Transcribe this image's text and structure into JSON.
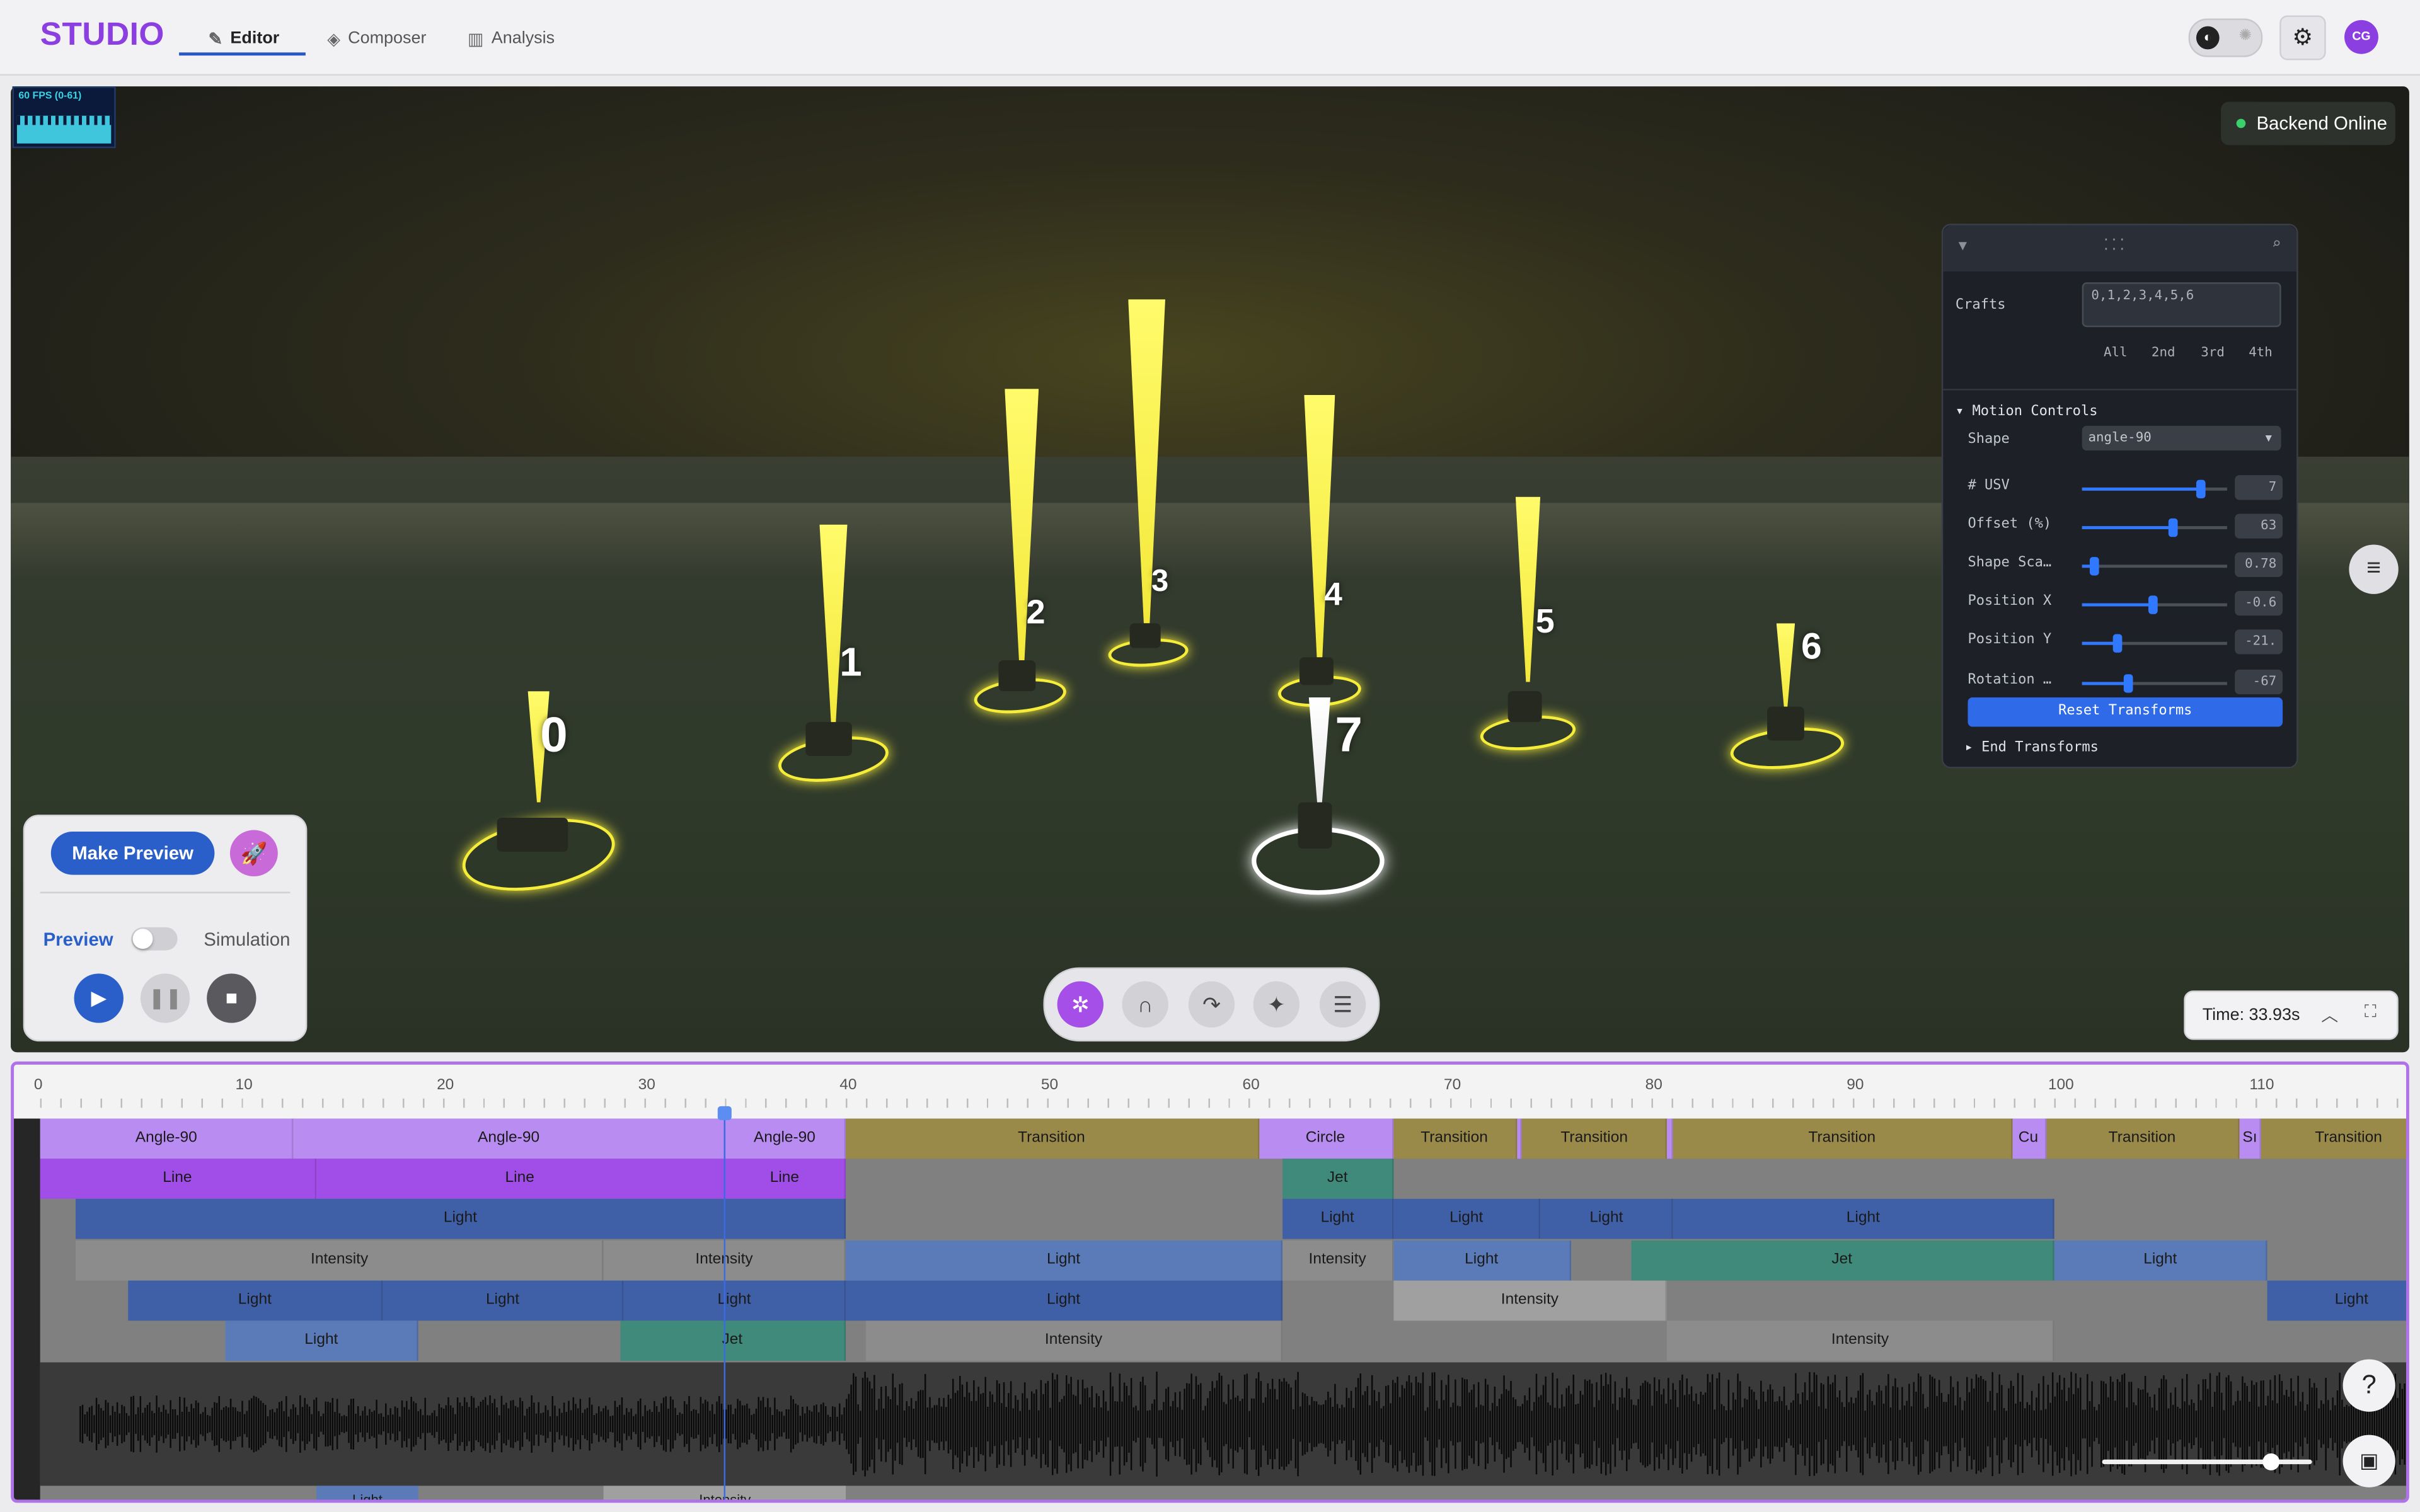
{
  "header": {
    "brand": "STUDIO",
    "tabs": [
      {
        "label": "Editor",
        "icon": "pencil-icon"
      },
      {
        "label": "Composer",
        "icon": "layers-icon"
      },
      {
        "label": "Analysis",
        "icon": "chart-icon"
      }
    ],
    "avatar": "CG"
  },
  "viewport": {
    "fps_label": "60 FPS (0-61)",
    "backend_status": "Backend Online",
    "drones": [
      "0",
      "1",
      "2",
      "3",
      "4",
      "5",
      "6",
      "7"
    ],
    "time_label": "Time: 33.93s"
  },
  "preview_panel": {
    "make_preview": "Make Preview",
    "preview_label": "Preview",
    "simulation_label": "Simulation"
  },
  "motion_panel": {
    "crafts_label": "Crafts",
    "crafts_value": "0,1,2,3,4,5,6",
    "quick_select": [
      "All",
      "2nd",
      "3rd",
      "4th"
    ],
    "section_title": "Motion Controls",
    "shape_label": "Shape",
    "shape_value": "angle-90",
    "sliders": [
      {
        "label": "# USV",
        "value": "7",
        "fraction": 0.82
      },
      {
        "label": "Offset (%)",
        "value": "63",
        "fraction": 0.63
      },
      {
        "label": "Shape Sca…",
        "value": "0.78",
        "fraction": 0.08
      },
      {
        "label": "Position X",
        "value": "-0.6",
        "fraction": 0.49
      },
      {
        "label": "Position Y",
        "value": "-21.",
        "fraction": 0.24
      },
      {
        "label": "Rotation …",
        "value": "-67",
        "fraction": 0.32
      }
    ],
    "reset_label": "Reset Transforms",
    "end_label": "End Transforms"
  },
  "timeline": {
    "ruler_ticks": [
      "0",
      "10",
      "20",
      "30",
      "40",
      "50",
      "60",
      "70",
      "80",
      "90",
      "100",
      "110"
    ],
    "playhead_time": 33.93,
    "tracks": [
      [
        {
          "s": 0,
          "e": 12.6,
          "label": "Angle-90",
          "c": "#b98cf2"
        },
        {
          "s": 12.6,
          "e": 34.0,
          "label": "Angle-90",
          "c": "#b98cf2"
        },
        {
          "s": 34.0,
          "e": 40.0,
          "label": "Angle-90",
          "c": "#b98cf2"
        },
        {
          "s": 40.0,
          "e": 60.5,
          "label": "Transition",
          "c": "#9a8a4a"
        },
        {
          "s": 60.5,
          "e": 67.2,
          "label": "Circle",
          "c": "#b98cf2"
        },
        {
          "s": 67.2,
          "e": 73.3,
          "label": "Transition",
          "c": "#9a8a4a"
        },
        {
          "s": 73.3,
          "e": 73.6,
          "label": "",
          "c": "#b98cf2"
        },
        {
          "s": 73.6,
          "e": 80.8,
          "label": "Transition",
          "c": "#9a8a4a"
        },
        {
          "s": 80.8,
          "e": 81.1,
          "label": "",
          "c": "#b98cf2"
        },
        {
          "s": 81.1,
          "e": 97.9,
          "label": "Transition",
          "c": "#9a8a4a"
        },
        {
          "s": 97.9,
          "e": 99.6,
          "label": "Cu",
          "c": "#b98cf2"
        },
        {
          "s": 99.6,
          "e": 109.2,
          "label": "Transition",
          "c": "#9a8a4a"
        },
        {
          "s": 109.2,
          "e": 110.3,
          "label": "Sı",
          "c": "#b98cf2"
        },
        {
          "s": 110.3,
          "e": 119.0,
          "label": "Transition",
          "c": "#9a8a4a"
        }
      ],
      [
        {
          "s": 0,
          "e": 13.7,
          "label": "Line",
          "c": "#a14ee8"
        },
        {
          "s": 13.7,
          "e": 34.0,
          "label": "Line",
          "c": "#a14ee8"
        },
        {
          "s": 34.0,
          "e": 40.0,
          "label": "Line",
          "c": "#a14ee8"
        },
        {
          "s": 61.7,
          "e": 67.2,
          "label": "Jet",
          "c": "#3f8a7a"
        }
      ],
      [
        {
          "s": 1.8,
          "e": 40.0,
          "label": "Light",
          "c": "#3f5fa6"
        },
        {
          "s": 61.7,
          "e": 67.2,
          "label": "Light",
          "c": "#3f5fa6"
        },
        {
          "s": 67.2,
          "e": 74.5,
          "label": "Light",
          "c": "#3f5fa6"
        },
        {
          "s": 74.5,
          "e": 81.1,
          "label": "Light",
          "c": "#3f5fa6"
        },
        {
          "s": 81.1,
          "e": 100.0,
          "label": "Light",
          "c": "#3f5fa6"
        }
      ],
      [
        {
          "s": 1.8,
          "e": 28.0,
          "label": "Intensity",
          "c": "#8c8c8c"
        },
        {
          "s": 28.0,
          "e": 40.0,
          "label": "Intensity",
          "c": "#8c8c8c"
        },
        {
          "s": 40.0,
          "e": 61.7,
          "label": "Light",
          "c": "#5a7ab8"
        },
        {
          "s": 61.7,
          "e": 67.2,
          "label": "Intensity",
          "c": "#8c8c8c"
        },
        {
          "s": 67.2,
          "e": 76.0,
          "label": "Light",
          "c": "#5a7ab8"
        },
        {
          "s": 79.0,
          "e": 100.0,
          "label": "Jet",
          "c": "#3f8a7a"
        },
        {
          "s": 100.0,
          "e": 110.6,
          "label": "Light",
          "c": "#5a7ab8"
        }
      ],
      [
        {
          "s": 4.4,
          "e": 17.0,
          "label": "Light",
          "c": "#3f5fa6"
        },
        {
          "s": 17.0,
          "e": 29.0,
          "label": "Light",
          "c": "#3f5fa6"
        },
        {
          "s": 29.0,
          "e": 40.0,
          "label": "Light",
          "c": "#3f5fa6"
        },
        {
          "s": 40.0,
          "e": 61.7,
          "label": "Light",
          "c": "#3f5fa6"
        },
        {
          "s": 67.2,
          "e": 80.8,
          "label": "Intensity",
          "c": "#a0a0a0"
        },
        {
          "s": 110.6,
          "e": 119.0,
          "label": "Light",
          "c": "#3f5fa6"
        }
      ],
      [
        {
          "s": 9.2,
          "e": 18.8,
          "label": "Light",
          "c": "#5a7ab8"
        },
        {
          "s": 28.8,
          "e": 40.0,
          "label": "Jet",
          "c": "#3f8a7a"
        },
        {
          "s": 41.0,
          "e": 61.7,
          "label": "Intensity",
          "c": "#8c8c8c"
        },
        {
          "s": 80.8,
          "e": 100.0,
          "label": "Intensity",
          "c": "#8c8c8c"
        }
      ]
    ],
    "bottom_track": [
      {
        "s": 13.7,
        "e": 18.8,
        "label": "Light",
        "c": "#5a7ab8"
      },
      {
        "s": 28.0,
        "e": 40.0,
        "label": "Intensity",
        "c": "#a0a0a0"
      }
    ]
  }
}
